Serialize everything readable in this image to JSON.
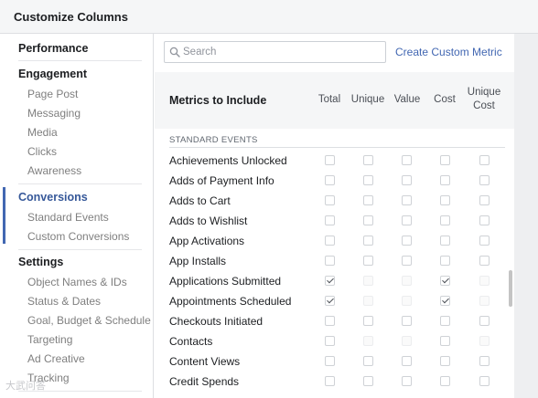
{
  "header": {
    "title": "Customize Columns"
  },
  "sidebar": {
    "groups": [
      {
        "label": "Performance"
      },
      {
        "label": "Engagement",
        "items": [
          "Page Post",
          "Messaging",
          "Media",
          "Clicks",
          "Awareness"
        ]
      },
      {
        "label": "Conversions",
        "items": [
          "Standard Events",
          "Custom Conversions"
        ]
      },
      {
        "label": "Settings",
        "items": [
          "Object Names & IDs",
          "Status & Dates",
          "Goal, Budget & Schedule",
          "Targeting",
          "Ad Creative",
          "Tracking"
        ]
      }
    ],
    "active_group": "Conversions"
  },
  "search": {
    "placeholder": "Search",
    "value": ""
  },
  "create_link": "Create Custom Metric",
  "metrics": {
    "title": "Metrics to Include",
    "columns": [
      "Total",
      "Unique",
      "Value",
      "Cost",
      "Unique Cost"
    ],
    "section": "STANDARD EVENTS",
    "rows": [
      {
        "label": "Achievements Unlocked",
        "state": [
          "u",
          "u",
          "u",
          "u",
          "u"
        ]
      },
      {
        "label": "Adds of Payment Info",
        "state": [
          "u",
          "u",
          "u",
          "u",
          "u"
        ]
      },
      {
        "label": "Adds to Cart",
        "state": [
          "u",
          "u",
          "u",
          "u",
          "u"
        ]
      },
      {
        "label": "Adds to Wishlist",
        "state": [
          "u",
          "u",
          "u",
          "u",
          "u"
        ]
      },
      {
        "label": "App Activations",
        "state": [
          "u",
          "u",
          "u",
          "u",
          "u"
        ]
      },
      {
        "label": "App Installs",
        "state": [
          "u",
          "u",
          "u",
          "u",
          "u"
        ]
      },
      {
        "label": "Applications Submitted",
        "state": [
          "c",
          "d",
          "d",
          "c",
          "d"
        ]
      },
      {
        "label": "Appointments Scheduled",
        "state": [
          "c",
          "d",
          "d",
          "c",
          "d"
        ]
      },
      {
        "label": "Checkouts Initiated",
        "state": [
          "u",
          "u",
          "u",
          "u",
          "u"
        ]
      },
      {
        "label": "Contacts",
        "state": [
          "u",
          "d",
          "d",
          "u",
          "d"
        ]
      },
      {
        "label": "Content Views",
        "state": [
          "u",
          "u",
          "u",
          "u",
          "u"
        ]
      },
      {
        "label": "Credit Spends",
        "state": [
          "u",
          "u",
          "u",
          "u",
          "u"
        ]
      }
    ]
  },
  "colors": {
    "accent": "#4267b2",
    "header_bg": "#f5f6f7",
    "border": "#dddfe2"
  },
  "watermark": "大武问答"
}
